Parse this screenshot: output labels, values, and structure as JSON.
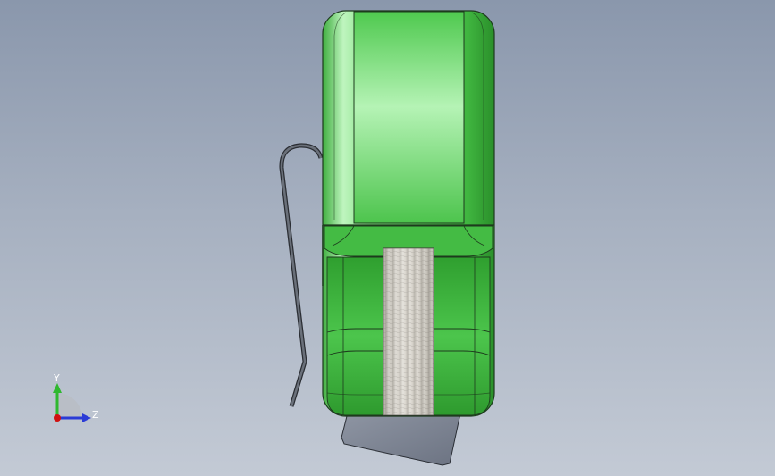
{
  "viewport": {
    "background_top": "#8a97ac",
    "background_bottom": "#c3cad5"
  },
  "model": {
    "body_color": "#5ed35e",
    "body_highlight": "#c9f7c9",
    "body_shadow": "#2d9e2d",
    "tape_color": "#cfcbc3",
    "clip_color": "#5b6069",
    "blade_color": "#7e8594"
  },
  "triad": {
    "x_axis_color": "#d01010",
    "y_axis_color": "#2fb82f",
    "z_axis_color": "#2b3bd6",
    "y_label": "Y",
    "z_label": "Z"
  }
}
